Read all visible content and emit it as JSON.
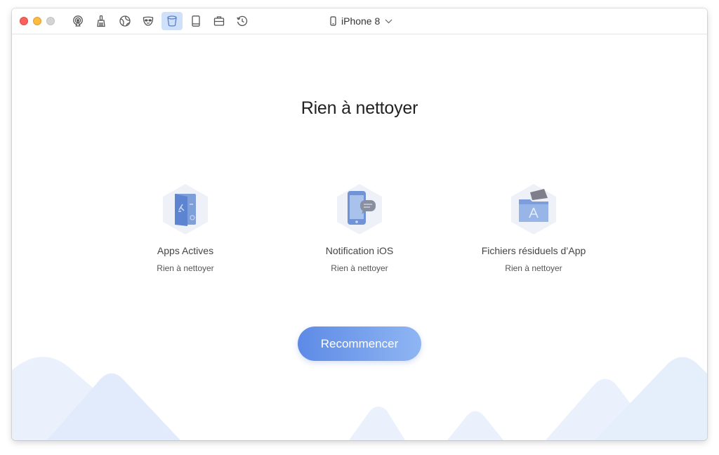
{
  "toolbar": {
    "tools": [
      {
        "icon": "airplay-icon",
        "active": false
      },
      {
        "icon": "broom-icon",
        "active": false
      },
      {
        "icon": "globe-icon",
        "active": false
      },
      {
        "icon": "mask-icon",
        "active": false
      },
      {
        "icon": "app-cleaner-icon",
        "active": true
      },
      {
        "icon": "tablet-icon",
        "active": false
      },
      {
        "icon": "briefcase-icon",
        "active": false
      },
      {
        "icon": "history-icon",
        "active": false
      }
    ],
    "device_name": "iPhone 8"
  },
  "main": {
    "headline": "Rien à nettoyer",
    "cards": [
      {
        "icon": "active-apps-icon",
        "title": "Apps Actives",
        "status": "Rien à nettoyer"
      },
      {
        "icon": "ios-notification-icon",
        "title": "Notification iOS",
        "status": "Rien à nettoyer"
      },
      {
        "icon": "app-junk-files-icon",
        "title": "Fichiers résiduels d’App",
        "status": "Rien à nettoyer"
      }
    ],
    "restart_label": "Recommencer"
  },
  "colors": {
    "accent": "#5d8ae6",
    "active_tool_bg": "#cfe0fa",
    "icon_hex_bg": "#eef2f8",
    "mountain_light": "#eaf1fc"
  }
}
